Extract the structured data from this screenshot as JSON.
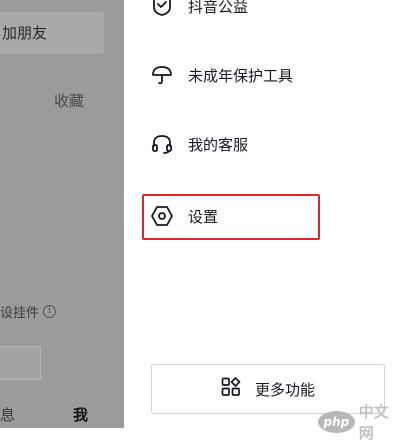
{
  "background": {
    "add_friend_label": "加朋友",
    "favorites_label": "收藏",
    "widget_label": "设挂件",
    "tabs": {
      "messages": "息",
      "me": "我"
    }
  },
  "drawer": {
    "items": [
      {
        "label": "抖音公益",
        "icon": "heart-hands-icon"
      },
      {
        "label": "未成年保护工具",
        "icon": "umbrella-icon"
      },
      {
        "label": "我的客服",
        "icon": "headset-icon"
      },
      {
        "label": "设置",
        "icon": "hexagon-gear-icon"
      }
    ],
    "more_button": {
      "label": "更多功能",
      "icon": "apps-grid-icon"
    }
  },
  "highlight_color": "#e0262b",
  "watermark": {
    "badge": "php",
    "text": "中文网"
  }
}
